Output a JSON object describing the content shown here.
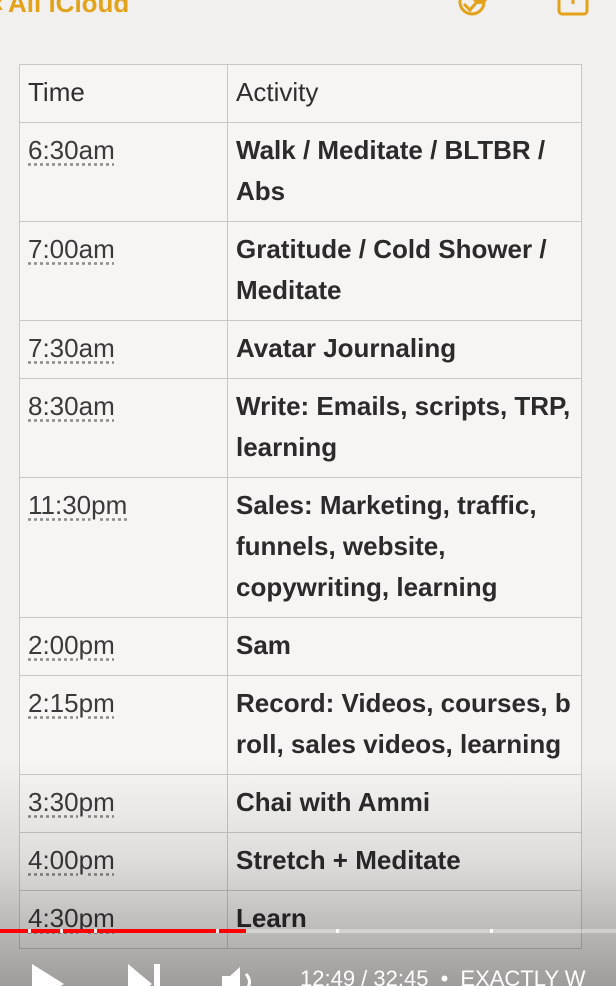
{
  "topbar": {
    "back_label": "All iCloud",
    "back_icon": "chevron-left-icon",
    "collab_icon": "collaborate-icon",
    "share_icon": "share-icon",
    "accent_color": "#e3a21a"
  },
  "table": {
    "headers": [
      "Time",
      "Activity"
    ],
    "rows": [
      {
        "time": "6:30am",
        "activity": "Walk / Meditate / BLTBR / Abs"
      },
      {
        "time": "7:00am",
        "activity": "Gratitude / Cold Shower / Meditate"
      },
      {
        "time": "7:30am",
        "activity": "Avatar Journaling"
      },
      {
        "time": "8:30am",
        "activity": "Write: Emails, scripts, TRP, learning"
      },
      {
        "time": "11:30pm",
        "activity": "Sales: Marketing, traffic, funnels, website, copywriting, learning"
      },
      {
        "time": "2:00pm",
        "activity": "Sam"
      },
      {
        "time": "2:15pm",
        "activity": "Record: Videos, courses, b roll, sales videos, learning"
      },
      {
        "time": "3:30pm",
        "activity": "Chai with Ammi"
      },
      {
        "time": "4:00pm",
        "activity": "Stretch + Meditate"
      },
      {
        "time": "4:30pm",
        "activity": "Learn"
      }
    ]
  },
  "player": {
    "progress_fraction": 0.4,
    "time_display": "12:49 / 32:45",
    "separator": "•",
    "chapter_title": "EXACTLY W",
    "progress_color": "#ff0000",
    "play_icon": "play-icon",
    "next_icon": "next-icon",
    "volume_icon": "volume-icon"
  }
}
